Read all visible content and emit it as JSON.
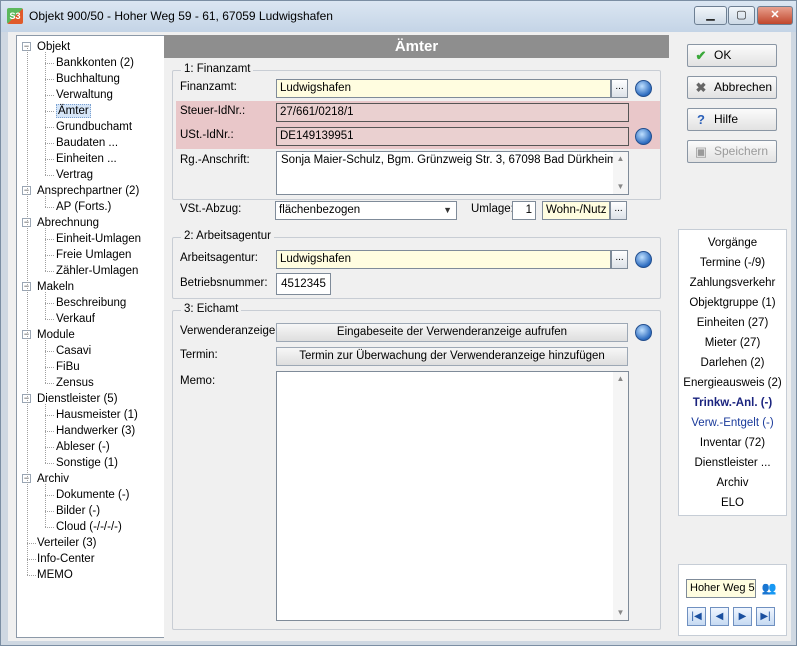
{
  "window": {
    "title": "Objekt 900/50 - Hoher Weg 59 - 61, 67059 Ludwigshafen",
    "app_icon_text": "S3",
    "controls": [
      "minimize",
      "maximize",
      "close"
    ]
  },
  "tree": {
    "items": [
      {
        "label": "Objekt",
        "level": 0,
        "expander": "−"
      },
      {
        "label": "Bankkonten (2)",
        "level": 1
      },
      {
        "label": "Buchhaltung",
        "level": 1
      },
      {
        "label": "Verwaltung",
        "level": 1
      },
      {
        "label": "Ämter",
        "level": 1,
        "selected": true
      },
      {
        "label": "Grundbuchamt",
        "level": 1
      },
      {
        "label": "Baudaten ...",
        "level": 1
      },
      {
        "label": "Einheiten ...",
        "level": 1
      },
      {
        "label": "Vertrag",
        "level": 1
      },
      {
        "label": "Ansprechpartner (2)",
        "level": 0,
        "expander": "−"
      },
      {
        "label": "AP (Forts.)",
        "level": 1
      },
      {
        "label": "Abrechnung",
        "level": 0,
        "expander": "−"
      },
      {
        "label": "Einheit-Umlagen",
        "level": 1
      },
      {
        "label": "Freie Umlagen",
        "level": 1
      },
      {
        "label": "Zähler-Umlagen",
        "level": 1
      },
      {
        "label": "Makeln",
        "level": 0,
        "expander": "−"
      },
      {
        "label": "Beschreibung",
        "level": 1
      },
      {
        "label": "Verkauf",
        "level": 1
      },
      {
        "label": "Module",
        "level": 0,
        "expander": "−"
      },
      {
        "label": "Casavi",
        "level": 1
      },
      {
        "label": "FiBu",
        "level": 1
      },
      {
        "label": "Zensus",
        "level": 1
      },
      {
        "label": "Dienstleister (5)",
        "level": 0,
        "expander": "−"
      },
      {
        "label": "Hausmeister (1)",
        "level": 1
      },
      {
        "label": "Handwerker (3)",
        "level": 1
      },
      {
        "label": "Ableser (-)",
        "level": 1
      },
      {
        "label": "Sonstige (1)",
        "level": 1
      },
      {
        "label": "Archiv",
        "level": 0,
        "expander": "−"
      },
      {
        "label": "Dokumente (-)",
        "level": 1
      },
      {
        "label": "Bilder (-)",
        "level": 1
      },
      {
        "label": "Cloud (-/-/-/-)",
        "level": 1
      },
      {
        "label": "Verteiler (3)",
        "level": 0
      },
      {
        "label": "Info-Center",
        "level": 0
      },
      {
        "label": "MEMO",
        "level": 0
      }
    ]
  },
  "main": {
    "header": "Ämter",
    "finanzamt": {
      "group_label": "1: Finanzamt",
      "finanzamt_label": "Finanzamt:",
      "finanzamt_value": "Ludwigshafen",
      "steuer_label": "Steuer-IdNr.:",
      "steuer_value": "27/661/0218/1",
      "ust_label": "USt.-IdNr.:",
      "ust_value": "DE149139951",
      "rg_label": "Rg.-Anschrift:",
      "rg_value": "Sonja Maier-Schulz, Bgm. Grünzweig Str. 3, 67098 Bad Dürkheim",
      "vst_label": "VSt.-Abzug:",
      "vst_value": "flächenbezogen",
      "umlage_label": "Umlage:",
      "umlage_value": "1",
      "umlage_type": "Wohn-/Nutz",
      "browse": "..."
    },
    "arbeitsagentur": {
      "group_label": "2: Arbeitsagentur",
      "agentur_label": "Arbeitsagentur:",
      "agentur_value": "Ludwigshafen",
      "betrieb_label": "Betriebsnummer:",
      "betrieb_value": "4512345"
    },
    "eichamt": {
      "group_label": "3: Eichamt",
      "verwender_label": "Verwenderanzeige:",
      "verwender_button": "Eingabeseite der Verwenderanzeige aufrufen",
      "termin_label": "Termin:",
      "termin_button": "Termin zur Überwachung der Verwenderanzeige hinzufügen",
      "memo_label": "Memo:",
      "memo_value": ""
    }
  },
  "actions": {
    "ok": "OK",
    "abbrechen": "Abbrechen",
    "hilfe": "Hilfe",
    "speichern": "Speichern"
  },
  "links": [
    {
      "label": "Vorgänge"
    },
    {
      "label": "Termine (-/9)"
    },
    {
      "label": "Zahlungsverkehr"
    },
    {
      "label": "Objektgruppe (1)"
    },
    {
      "label": "Einheiten (27)"
    },
    {
      "label": "Mieter (27)"
    },
    {
      "label": "Darlehen (2)"
    },
    {
      "label": "Energieausweis (2)"
    },
    {
      "label": "Trinkw.-Anl. (-)",
      "style": "bold"
    },
    {
      "label": "Verw.-Entgelt (-)",
      "style": "blue"
    },
    {
      "label": "Inventar (72)"
    },
    {
      "label": "Dienstleister ..."
    },
    {
      "label": "Archiv"
    },
    {
      "label": "ELO"
    }
  ],
  "nav": {
    "search_value": "Hoher Weg 5",
    "buttons": [
      "first",
      "prev",
      "next",
      "last"
    ]
  },
  "colors": {
    "header_bg": "#8e8e8e",
    "highlight": "#e7b9bc",
    "required_field": "#fffde0"
  }
}
